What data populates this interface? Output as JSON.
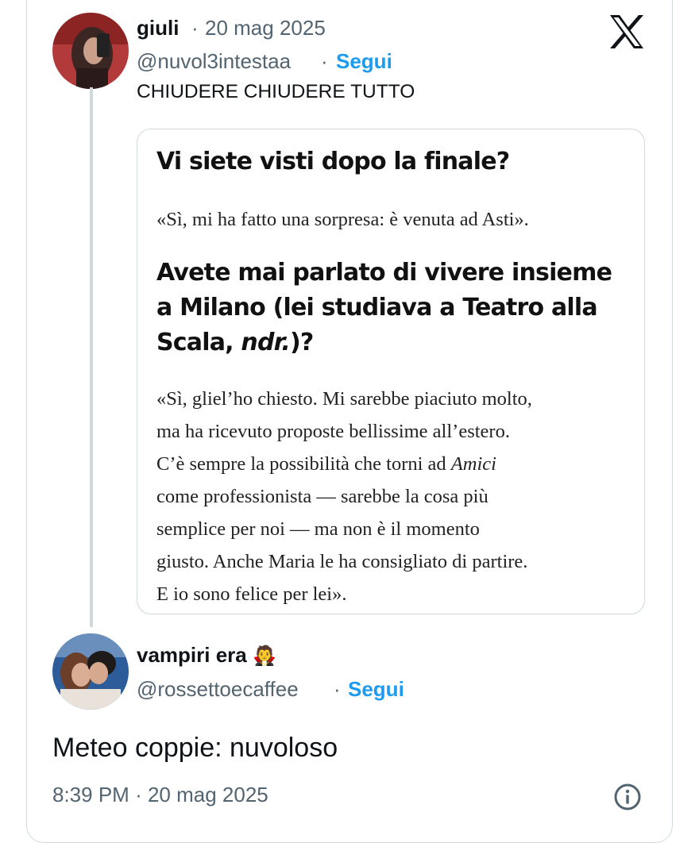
{
  "tweet1": {
    "display_name": "giuli",
    "separator": "·",
    "date": "20 mag 2025",
    "handle": "@nuvol3intestaa",
    "follow_label": "Segui",
    "text": "CHIUDERE CHIUDERE TUTTO"
  },
  "quote": {
    "heading1": "Vi siete visti dopo la finale?",
    "answer1": "«Sì, mi ha fatto una sorpresa: è venuta ad Asti».",
    "heading2_line1": "Avete mai parlato di vivere insieme",
    "heading2_line2": "a Milano (lei studiava a Teatro alla",
    "heading2_line3_a": "Scala, ",
    "heading2_line3_italic": "ndr.",
    "heading2_line3_b": ")?",
    "answer2_line1": "«Sì, glielʼho chiesto. Mi sarebbe piaciuto molto,",
    "answer2_line2": "ma ha ricevuto proposte bellissime allʼestero.",
    "answer2_line3_a": "Cʼè sempre la possibilità che torni ad ",
    "answer2_line3_italic": "Amici",
    "answer2_line4": "come professionista — sarebbe la cosa più",
    "answer2_line5": "semplice per noi — ma non è il momento",
    "answer2_line6": "giusto. Anche Maria le ha consigliato di partire.",
    "answer2_line7": "E io sono felice per lei»."
  },
  "tweet2": {
    "display_name": "vampiri era",
    "emoji": "🧛",
    "handle": "@rossettoecaffee",
    "separator": "·",
    "follow_label": "Segui",
    "text": "Meteo coppie: nuvoloso",
    "time": "8:39 PM",
    "date": "20 mag 2025"
  },
  "icons": {
    "brand": "x-logo-icon",
    "info": "info-icon",
    "avatar1": "avatar-giuli",
    "avatar2": "avatar-vampiri-era"
  },
  "colors": {
    "link": "#1d9bf0",
    "muted": "#536471",
    "border": "#cfd9de",
    "text": "#0f1419"
  }
}
